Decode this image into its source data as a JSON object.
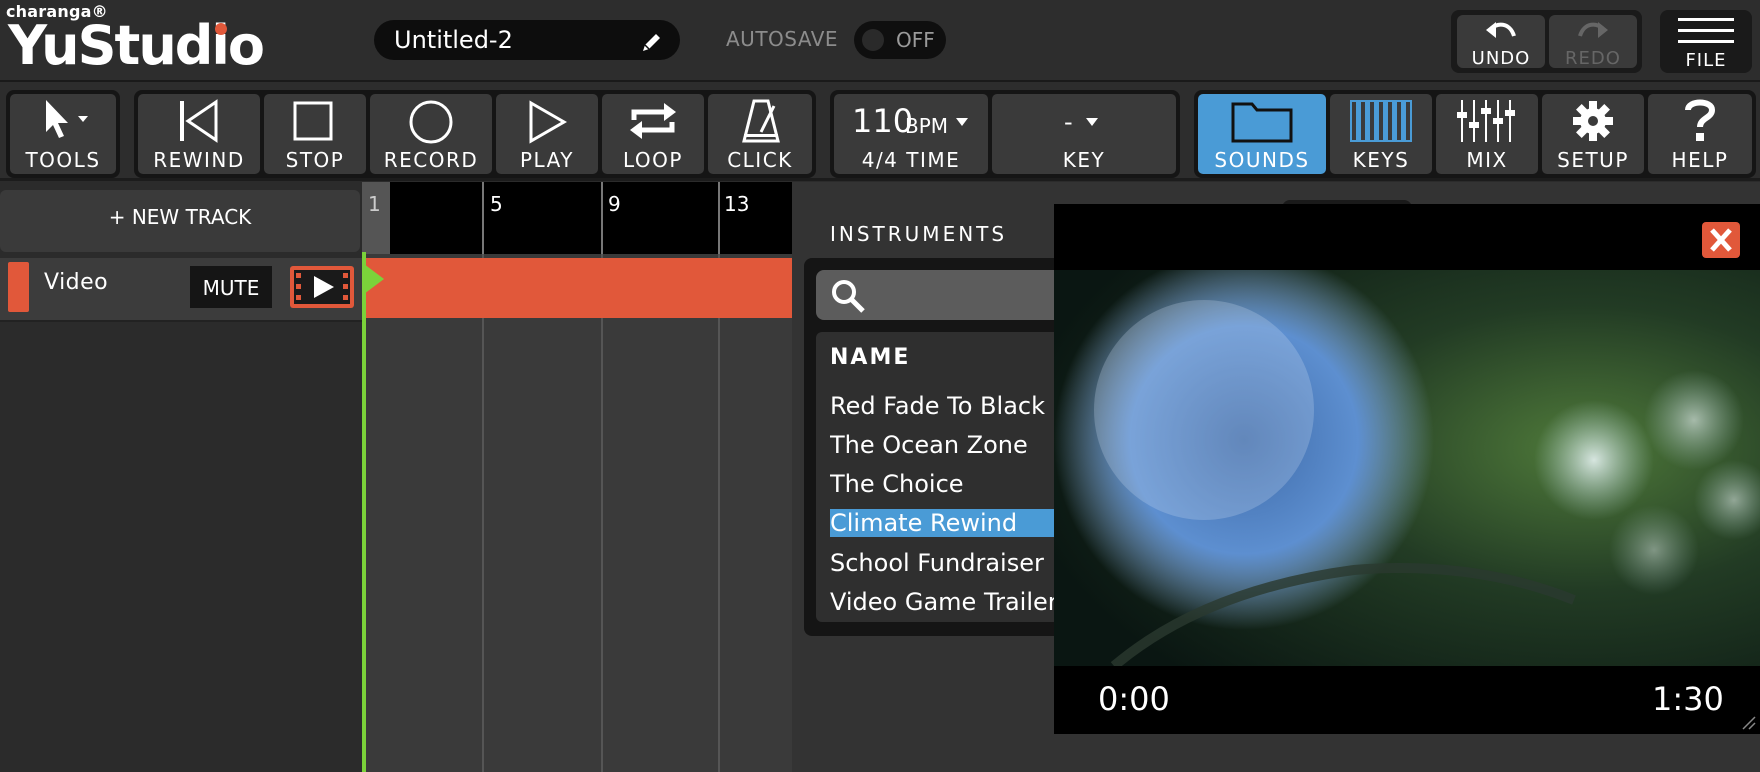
{
  "brand": {
    "small": "charanga®",
    "large": "YuStudio"
  },
  "project": {
    "title": "Untitled-2"
  },
  "autosave": {
    "label": "AUTOSAVE",
    "state": "OFF"
  },
  "history": {
    "undo": "UNDO",
    "redo": "REDO"
  },
  "file": {
    "label": "FILE"
  },
  "toolbar": {
    "tools": "TOOLS",
    "rewind": "REWIND",
    "stop": "STOP",
    "record": "RECORD",
    "play": "PLAY",
    "loop": "LOOP",
    "click": "CLICK",
    "bpm_value": "110",
    "bpm_unit": "BPM",
    "time_sig": "4/4 TIME",
    "key_value": "-",
    "key_label": "KEY",
    "sounds": "SOUNDS",
    "keys": "KEYS",
    "mix": "MIX",
    "setup": "SETUP",
    "help": "HELP"
  },
  "tracks": {
    "new_track": "+ NEW TRACK",
    "items": [
      {
        "name": "Video",
        "mute": "MUTE",
        "color": "#e1583a"
      }
    ]
  },
  "ruler": {
    "bars": [
      "1",
      "5",
      "9",
      "13"
    ]
  },
  "instruments": {
    "title": "INSTRUMENTS",
    "column": "NAME",
    "items": [
      "Red Fade To Black",
      "The Ocean Zone",
      "The Choice",
      "Climate Rewind",
      "School Fundraiser",
      "Video Game Trailer"
    ],
    "selected_index": 3
  },
  "video": {
    "time_start": "0:00",
    "time_end": "1:30"
  },
  "colors": {
    "accent": "#e1583a",
    "active": "#4a9bd6",
    "playhead": "#7bd23a"
  }
}
